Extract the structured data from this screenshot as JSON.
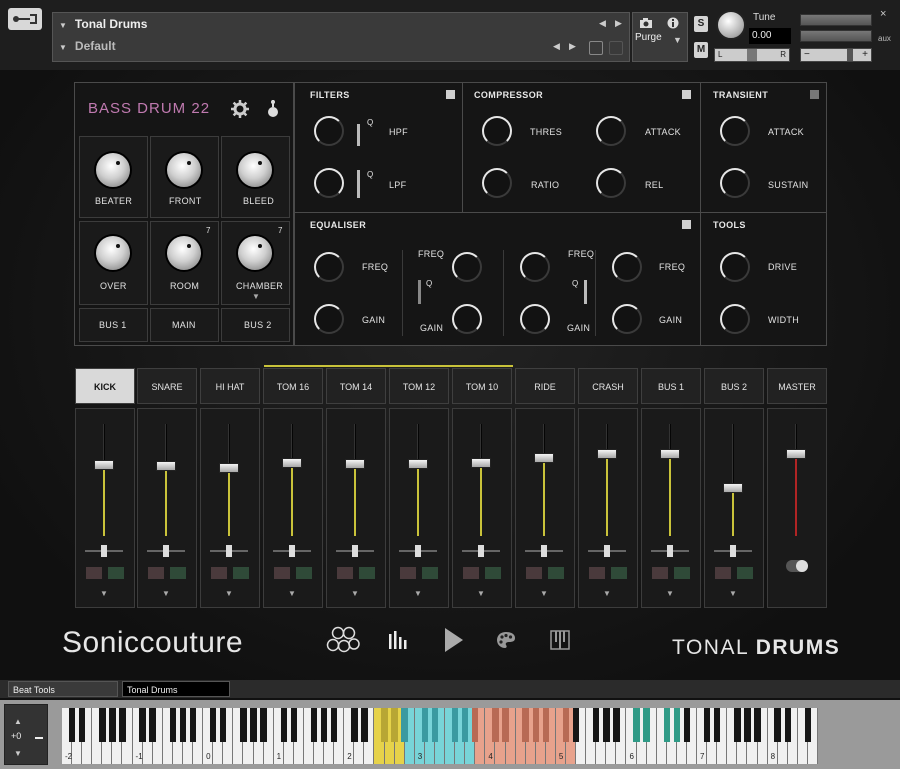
{
  "header": {
    "instrument_name": "Tonal Drums",
    "preset_name": "Default",
    "purge_label": "Purge",
    "solo_label": "S",
    "mute_label": "M",
    "tune_label": "Tune",
    "tune_value": "0.00",
    "left_label": "L",
    "right_label": "R",
    "aux_label": "aux",
    "close_label": "×",
    "minus_label": "−",
    "plus_label": "+"
  },
  "drum_panel": {
    "title": "BASS DRUM 22",
    "knobs": [
      "BEATER",
      "FRONT",
      "BLEED",
      "OVER",
      "ROOM",
      "CHAMBER"
    ],
    "room_superscript": "7",
    "chamber_superscript": "7",
    "buses": [
      "BUS 1",
      "MAIN",
      "BUS 2"
    ]
  },
  "filters": {
    "title": "FILTERS",
    "q_label": "Q",
    "hpf": "HPF",
    "lpf": "LPF"
  },
  "compressor": {
    "title": "COMPRESSOR",
    "thres": "THRES",
    "ratio": "RATIO",
    "attack": "ATTACK",
    "rel": "REL"
  },
  "transient": {
    "title": "TRANSIENT",
    "attack": "ATTACK",
    "sustain": "SUSTAIN"
  },
  "equaliser": {
    "title": "EQUALISER",
    "freq": "FREQ",
    "gain": "GAIN",
    "q_label": "Q"
  },
  "tools": {
    "title": "TOOLS",
    "drive": "DRIVE",
    "width": "WIDTH"
  },
  "mixer": {
    "channels": [
      {
        "name": "KICK",
        "level": 0.68,
        "color": "#c9c33a"
      },
      {
        "name": "SNARE",
        "level": 0.67,
        "color": "#c9c33a"
      },
      {
        "name": "HI HAT",
        "level": 0.65,
        "color": "#c9c33a"
      },
      {
        "name": "TOM 16",
        "level": 0.7,
        "color": "#c9c33a"
      },
      {
        "name": "TOM 14",
        "level": 0.69,
        "color": "#c9c33a"
      },
      {
        "name": "TOM 12",
        "level": 0.69,
        "color": "#c9c33a"
      },
      {
        "name": "TOM 10",
        "level": 0.7,
        "color": "#c9c33a"
      },
      {
        "name": "RIDE",
        "level": 0.74,
        "color": "#c9c33a"
      },
      {
        "name": "CRASH",
        "level": 0.78,
        "color": "#c9c33a"
      },
      {
        "name": "BUS 1",
        "level": 0.78,
        "color": "#c9c33a"
      },
      {
        "name": "BUS 2",
        "level": 0.47,
        "color": "#c9c33a"
      },
      {
        "name": "MASTER",
        "level": 0.78,
        "color": "#b02424"
      }
    ],
    "selected": "KICK"
  },
  "footer": {
    "brand": "Soniccouture",
    "product_light": "TONAL",
    "product_bold": "DRUMS",
    "nav_icons": [
      "drums-icon",
      "mixer-icon",
      "play-icon",
      "palette-icon",
      "keyboard-icon"
    ]
  },
  "bottom_tabs": [
    "Beat Tools",
    "Tonal Drums"
  ],
  "keyboard": {
    "octave_shift": "+0",
    "octave_labels": [
      "-2",
      "-1",
      "0",
      "1",
      "2",
      "3",
      "4",
      "5",
      "6",
      "7",
      "8"
    ]
  },
  "colors": {
    "accent_pink": "#c07ab0",
    "accent_yellow": "#c9c33a",
    "master_red": "#b02424",
    "key_yellow": "#e6d24a",
    "key_cyan": "#78d4d8",
    "key_salmon": "#e8a28c",
    "key_teal": "#2f9a86"
  }
}
